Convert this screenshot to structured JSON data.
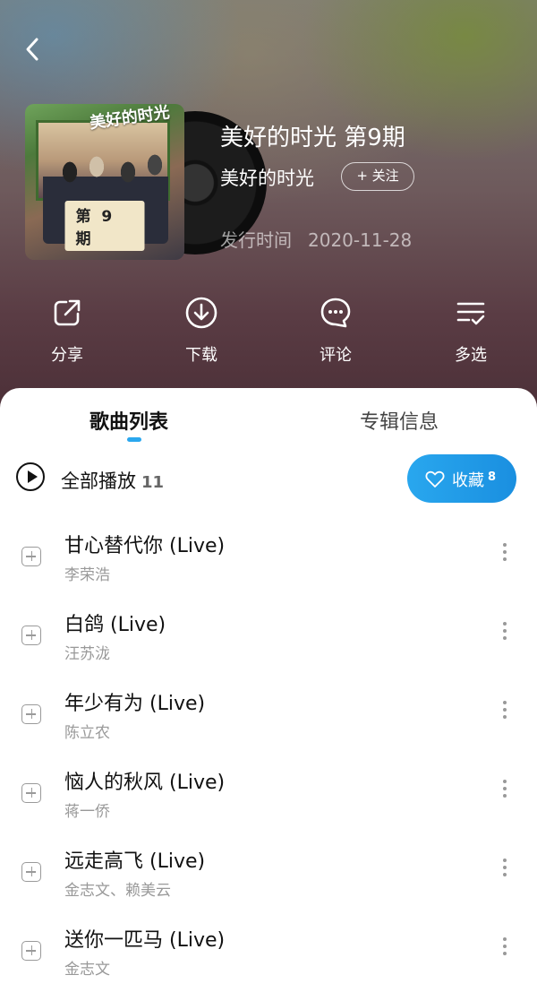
{
  "header": {
    "back_icon": "chevron-left-icon"
  },
  "album": {
    "title": "美好的时光 第9期",
    "artist": "美好的时光",
    "follow_label": "+ 关注",
    "release_label": "发行时间",
    "release_date": "2020-11-28",
    "cover": {
      "logo_text": "美好的时光",
      "badge_text": "第 9 期"
    }
  },
  "actions": [
    {
      "label": "分享",
      "icon": "share-icon"
    },
    {
      "label": "下载",
      "icon": "download-icon"
    },
    {
      "label": "评论",
      "icon": "comment-icon"
    },
    {
      "label": "多选",
      "icon": "multi-select-icon"
    }
  ],
  "tabs": {
    "songs": "歌曲列表",
    "album_info": "专辑信息"
  },
  "play_all": {
    "label": "全部播放",
    "count": "11"
  },
  "collect": {
    "label": "收藏",
    "count": "8"
  },
  "songs": [
    {
      "title": "甘心替代你 (Live)",
      "artist": "李荣浩"
    },
    {
      "title": "白鸽 (Live)",
      "artist": "汪苏泷"
    },
    {
      "title": "年少有为 (Live)",
      "artist": "陈立农"
    },
    {
      "title": "恼人的秋风 (Live)",
      "artist": "蒋一侨"
    },
    {
      "title": "远走高飞 (Live)",
      "artist": "金志文、赖美云"
    },
    {
      "title": "送你一匹马 (Live)",
      "artist": "金志文"
    }
  ],
  "colors": {
    "accent": "#2aa7ee",
    "collect_button": "#1a8fe0",
    "secondary_text": "#999999"
  }
}
